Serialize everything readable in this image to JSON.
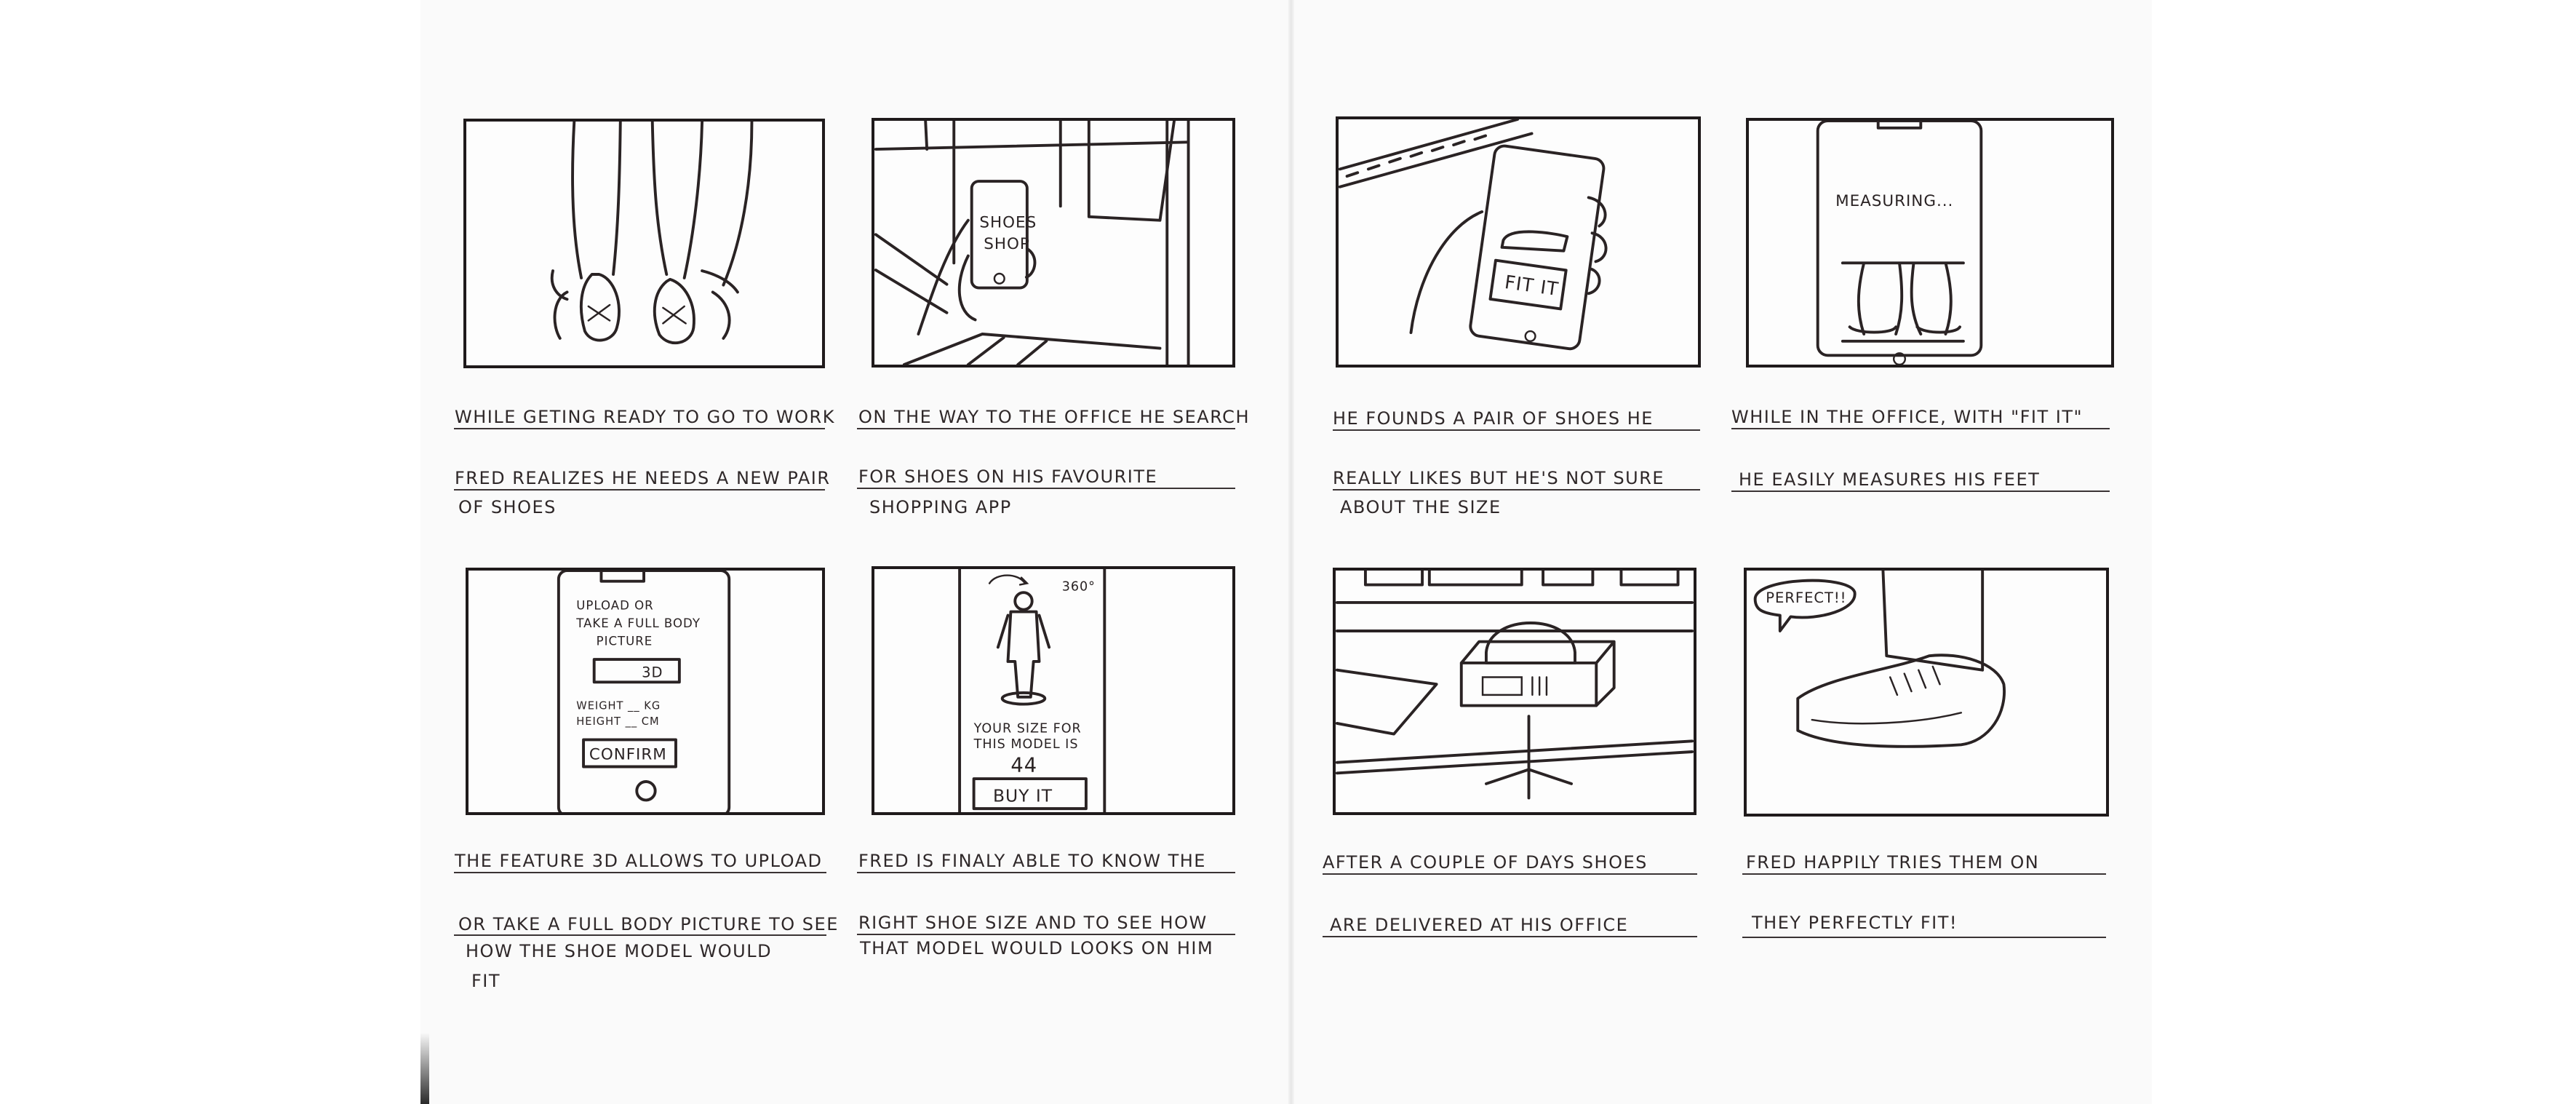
{
  "storyboard": {
    "panels": [
      {
        "id": 1,
        "screen_text": [],
        "caption_lines": [
          "WHILE GETING READY TO GO TO WORK",
          "FRED REALIZES HE NEEDS A NEW PAIR",
          "OF SHOES"
        ]
      },
      {
        "id": 2,
        "screen_text": [
          "SHOES",
          "SHOP"
        ],
        "caption_lines": [
          "ON THE WAY TO THE OFFICE HE SEARCH",
          "FOR SHOES ON HIS FAVOURITE",
          "SHOPPING APP"
        ]
      },
      {
        "id": 3,
        "screen_text": [
          "FIT IT"
        ],
        "caption_lines": [
          "HE FOUNDS A PAIR OF SHOES HE",
          "REALLY LIKES BUT HE'S NOT SURE",
          "ABOUT THE SIZE"
        ]
      },
      {
        "id": 4,
        "screen_text": [
          "MEASURING..."
        ],
        "caption_lines": [
          "WHILE IN THE OFFICE, WITH \"FIT IT\"",
          "HE EASILY MEASURES HIS FEET"
        ]
      },
      {
        "id": 5,
        "screen_text": [
          "UPLOAD OR",
          "TAKE A FULL BODY",
          "PICTURE",
          "3D",
          "WEIGHT __ KG",
          "HEIGHT __ CM",
          "CONFIRM"
        ],
        "caption_lines": [
          "THE FEATURE 3D ALLOWS TO UPLOAD",
          "OR TAKE A FULL BODY PICTURE TO SEE",
          "HOW THE SHOE MODEL WOULD",
          "FIT"
        ]
      },
      {
        "id": 6,
        "screen_text": [
          "360°",
          "YOUR SIZE FOR",
          "THIS MODEL IS",
          "44",
          "BUY IT"
        ],
        "caption_lines": [
          "FRED IS FINALY ABLE TO KNOW THE",
          "RIGHT SHOE SIZE AND TO SEE HOW",
          "THAT MODEL WOULD LOOKS ON HIM"
        ]
      },
      {
        "id": 7,
        "screen_text": [],
        "caption_lines": [
          "AFTER A COUPLE OF DAYS SHOES",
          "ARE DELIVERED AT HIS OFFICE"
        ]
      },
      {
        "id": 8,
        "screen_text": [
          "PERFECT!!"
        ],
        "caption_lines": [
          "FRED HAPPILY TRIES THEM ON",
          "THEY PERFECTLY FIT!"
        ]
      }
    ]
  },
  "colors": {
    "ink": "#2a2324",
    "paper": "#fafafa",
    "background": "#ffffff"
  }
}
